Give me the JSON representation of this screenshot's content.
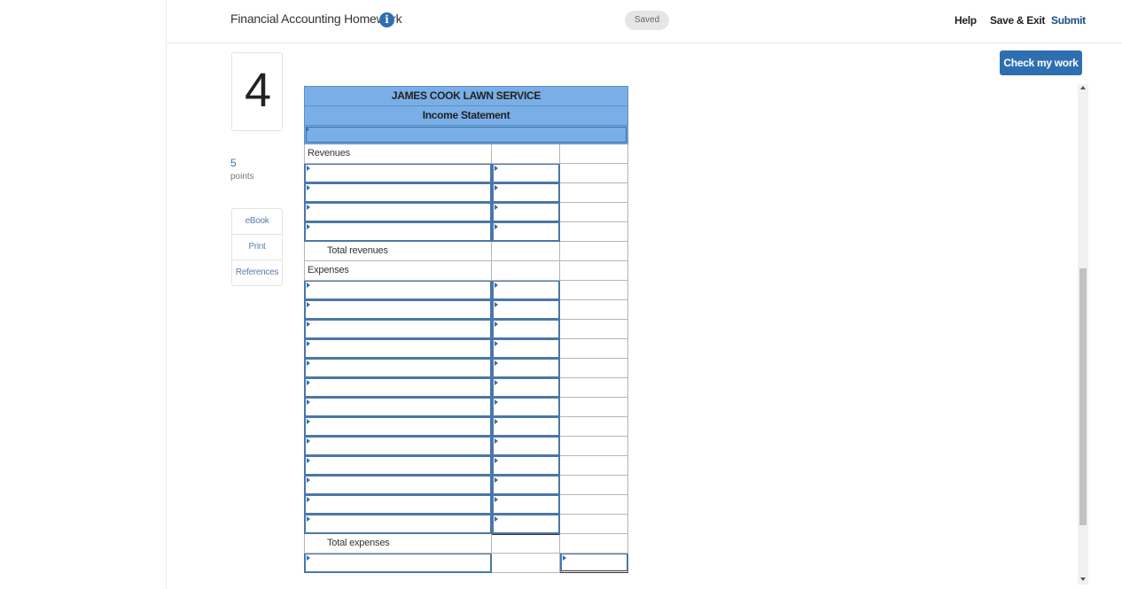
{
  "header": {
    "title": "Financial Accounting Homework",
    "info_icon": "info-icon",
    "saved_label": "Saved",
    "help_label": "Help",
    "save_exit_label": "Save & Exit",
    "submit_label": "Submit"
  },
  "check_button_label": "Check my work",
  "question": {
    "number": "4",
    "points_value": "5",
    "points_label": "points"
  },
  "side_links": [
    "eBook",
    "Print",
    "References"
  ],
  "statement": {
    "company": "JAMES COOK LAWN SERVICE",
    "title": "Income Statement",
    "revenues_label": "Revenues",
    "total_revenues_label": "Total revenues",
    "expenses_label": "Expenses",
    "total_expenses_label": "Total expenses"
  },
  "colors": {
    "accent": "#2e6fb1",
    "header_fill": "#7aaee6"
  }
}
